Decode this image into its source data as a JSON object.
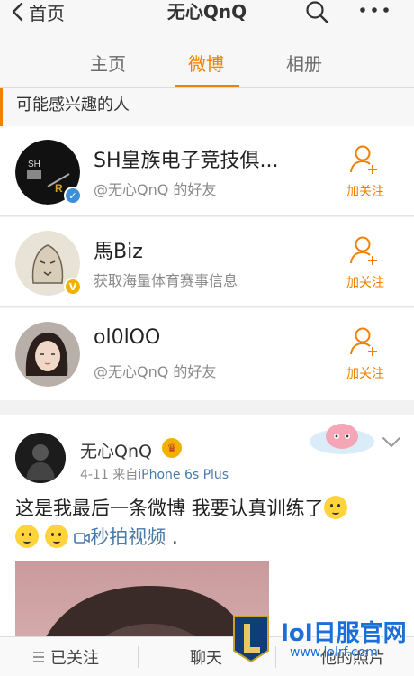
{
  "nav": {
    "back_label": "首页",
    "title": "无心QnQ"
  },
  "tabs": [
    {
      "label": "主页",
      "active": false
    },
    {
      "label": "微博",
      "active": true
    },
    {
      "label": "相册",
      "active": false
    }
  ],
  "section": {
    "title": "可能感兴趣的人"
  },
  "suggestions": [
    {
      "name": "SH皇族电子竞技俱...",
      "subtitle": "@无心QnQ 的好友",
      "follow_label": "加关注",
      "verified_color": "#3d8fd6"
    },
    {
      "name": "馬Biz",
      "subtitle": "获取海量体育赛事信息",
      "follow_label": "加关注",
      "verified_color": "#f2b100"
    },
    {
      "name": "ol0lOO",
      "subtitle": "@无心QnQ 的好友",
      "follow_label": "加关注",
      "verified_color": ""
    }
  ],
  "post": {
    "author": "无心QnQ",
    "date": "4-11",
    "source_prefix": "来自",
    "source": "iPhone 6s Plus",
    "text": "这是我最后一条微博 我要认真训练了",
    "video_link": "秒拍视频",
    "trailing": " ."
  },
  "bottom_bar": {
    "followed_label": "已关注",
    "chat_label": "聊天",
    "third_label": "他的照片"
  },
  "watermark": {
    "title": "lol日服官网",
    "url": "www.lolrf.com"
  },
  "colors": {
    "accent": "#f08100",
    "link": "#4a7aa8",
    "verified_blue": "#3d8fd6",
    "verified_gold": "#f2b100"
  }
}
